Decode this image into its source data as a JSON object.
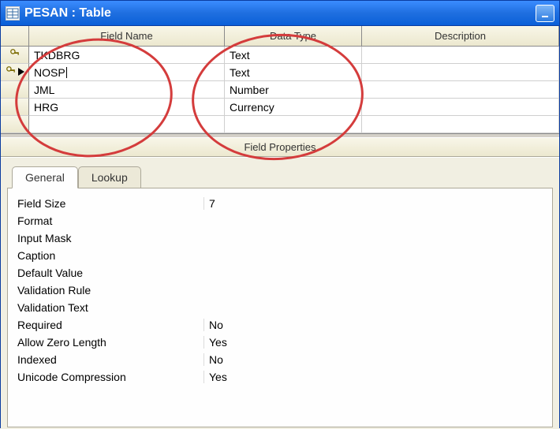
{
  "window": {
    "title": "PESAN : Table"
  },
  "columns": {
    "fieldname": "Field Name",
    "datatype": "Data Type",
    "description": "Description"
  },
  "rows": [
    {
      "key": true,
      "current": false,
      "field": "TKDBRG",
      "type": "Text",
      "desc": ""
    },
    {
      "key": true,
      "current": true,
      "field": "NOSP",
      "type": "Text",
      "desc": ""
    },
    {
      "key": false,
      "current": false,
      "field": "JML",
      "type": "Number",
      "desc": ""
    },
    {
      "key": false,
      "current": false,
      "field": "HRG",
      "type": "Currency",
      "desc": ""
    }
  ],
  "fieldprops_label": "Field Properties",
  "tabs": {
    "general": "General",
    "lookup": "Lookup"
  },
  "props": [
    {
      "label": "Field Size",
      "value": "7"
    },
    {
      "label": "Format",
      "value": ""
    },
    {
      "label": "Input Mask",
      "value": ""
    },
    {
      "label": "Caption",
      "value": ""
    },
    {
      "label": "Default Value",
      "value": ""
    },
    {
      "label": "Validation Rule",
      "value": ""
    },
    {
      "label": "Validation Text",
      "value": ""
    },
    {
      "label": "Required",
      "value": "No"
    },
    {
      "label": "Allow Zero Length",
      "value": "Yes"
    },
    {
      "label": "Indexed",
      "value": "No"
    },
    {
      "label": "Unicode Compression",
      "value": "Yes"
    }
  ]
}
